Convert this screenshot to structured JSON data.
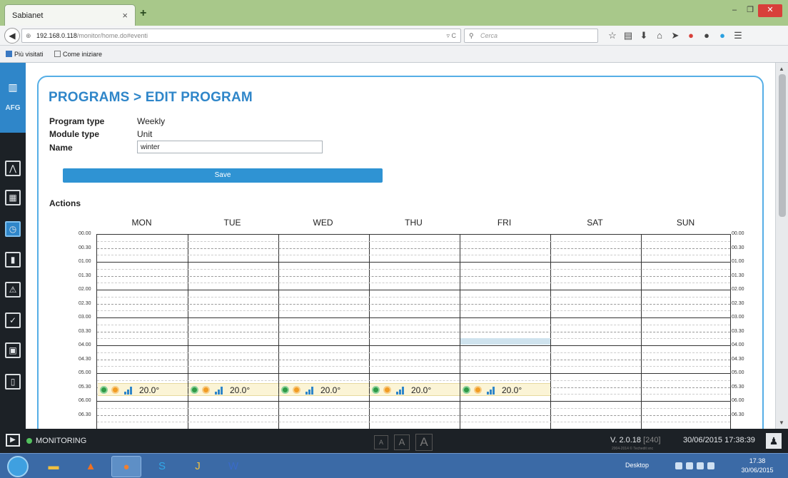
{
  "browser": {
    "tab_title": "Sabianet",
    "tab_close": "×",
    "new_tab": "+",
    "url_host": "192.168.0.118",
    "url_path": "/monitor/home.do#eventi",
    "search_placeholder": "Cerca",
    "win_min": "–",
    "win_restore": "❐",
    "win_close": "✕",
    "bookmarks": [
      "Più visitati",
      "Come iniziare"
    ]
  },
  "sidebar": {
    "logo_text": "AFG",
    "items": [
      "chart-icon",
      "modules-icon",
      "clock-icon",
      "stats-icon",
      "alarm-icon",
      "check-icon",
      "lock-icon",
      "device-icon"
    ],
    "active_index": 2
  },
  "page": {
    "title": "PROGRAMS > EDIT PROGRAM",
    "fields": [
      {
        "label": "Program type",
        "value": "Weekly"
      },
      {
        "label": "Module type",
        "value": "Unit"
      }
    ],
    "name_label": "Name",
    "name_value": "winter",
    "save_label": "Save",
    "actions_label": "Actions"
  },
  "schedule": {
    "days": [
      "MON",
      "TUE",
      "WED",
      "THU",
      "FRI",
      "SAT",
      "SUN"
    ],
    "times": [
      "00.00",
      "00.30",
      "01.00",
      "01.30",
      "02.00",
      "02.30",
      "03.00",
      "03.30",
      "04.00",
      "04.30",
      "05.00",
      "05.30",
      "06.00",
      "06.30"
    ],
    "events": [
      {
        "day": "MON",
        "time": "05.30",
        "temp": "20.0°"
      },
      {
        "day": "TUE",
        "time": "05.30",
        "temp": "20.0°"
      },
      {
        "day": "WED",
        "time": "05.30",
        "temp": "20.0°"
      },
      {
        "day": "THU",
        "time": "05.30",
        "temp": "20.0°"
      },
      {
        "day": "FRI",
        "time": "05.30",
        "temp": "20.0°"
      }
    ],
    "highlight": {
      "day": "FRI",
      "time": "04.00"
    },
    "partial_days": [
      "MON",
      "TUE",
      "WED",
      "THU",
      "FRI"
    ]
  },
  "statusbar": {
    "mode": "MONITORING",
    "font_sizes": [
      "A",
      "A",
      "A"
    ],
    "version": "V. 2.0.18",
    "build": "[240]",
    "copyright": "2004-2014 © Techedit snc",
    "datetime": "30/06/2015 17:38:39"
  },
  "taskbar": {
    "desktop_label": "Desktop",
    "clock_time": "17.38",
    "clock_date": "30/06/2015"
  },
  "colors": {
    "accent": "#2f86c9",
    "card_border": "#55aee6",
    "event_bg": "#fbf4d6",
    "status_green": "#53c15e"
  }
}
